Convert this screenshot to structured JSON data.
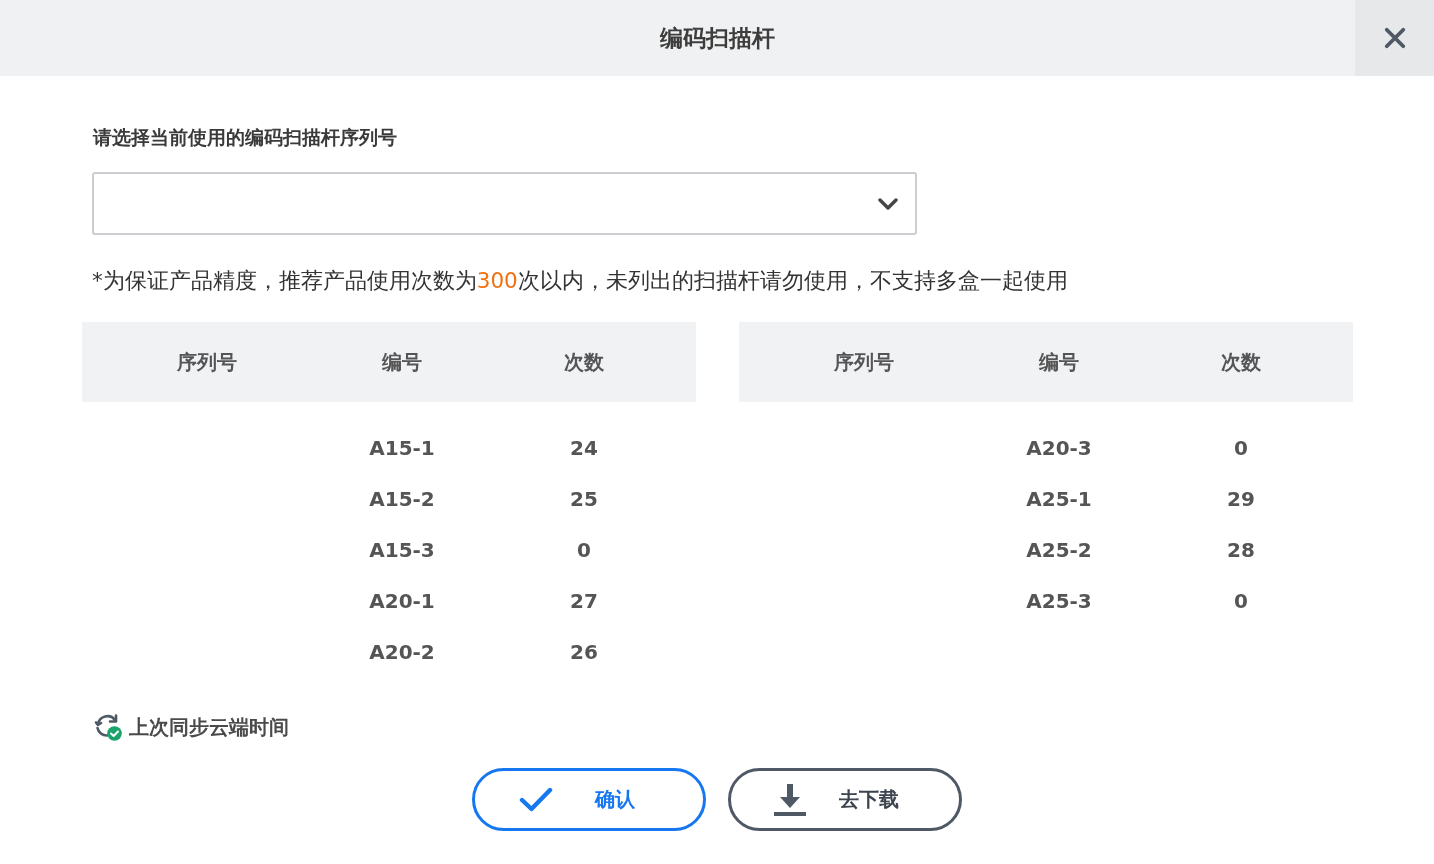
{
  "dialog": {
    "title": "编码扫描杆"
  },
  "serial_select": {
    "label": "请选择当前使用的编码扫描杆序列号"
  },
  "notice": [
    {
      "text": "*为保证产品精度，推荐产品使用次数为",
      "highlight": false
    },
    {
      "text": "300",
      "highlight": true
    },
    {
      "text": "次以内，未列出的扫描杆请勿使用，不支持多盒一起使用",
      "highlight": false
    }
  ],
  "tables": [
    {
      "columns": [
        "序列号",
        "编号",
        "次数"
      ],
      "rows": [
        {
          "code": "A15-1",
          "count": "24"
        },
        {
          "code": "A15-2",
          "count": "25"
        },
        {
          "code": "A15-3",
          "count": "0"
        },
        {
          "code": "A20-1",
          "count": "27"
        },
        {
          "code": "A20-2",
          "count": "26"
        }
      ]
    },
    {
      "columns": [
        "序列号",
        "编号",
        "次数"
      ],
      "rows": [
        {
          "code": "A20-3",
          "count": "0"
        },
        {
          "code": "A25-1",
          "count": "29"
        },
        {
          "code": "A25-2",
          "count": "28"
        },
        {
          "code": "A25-3",
          "count": "0"
        }
      ]
    }
  ],
  "sync": {
    "label": "上次同步云端时间"
  },
  "buttons": [
    {
      "kind": "confirm",
      "label": "确认"
    },
    {
      "kind": "download",
      "label": "去下载"
    }
  ]
}
